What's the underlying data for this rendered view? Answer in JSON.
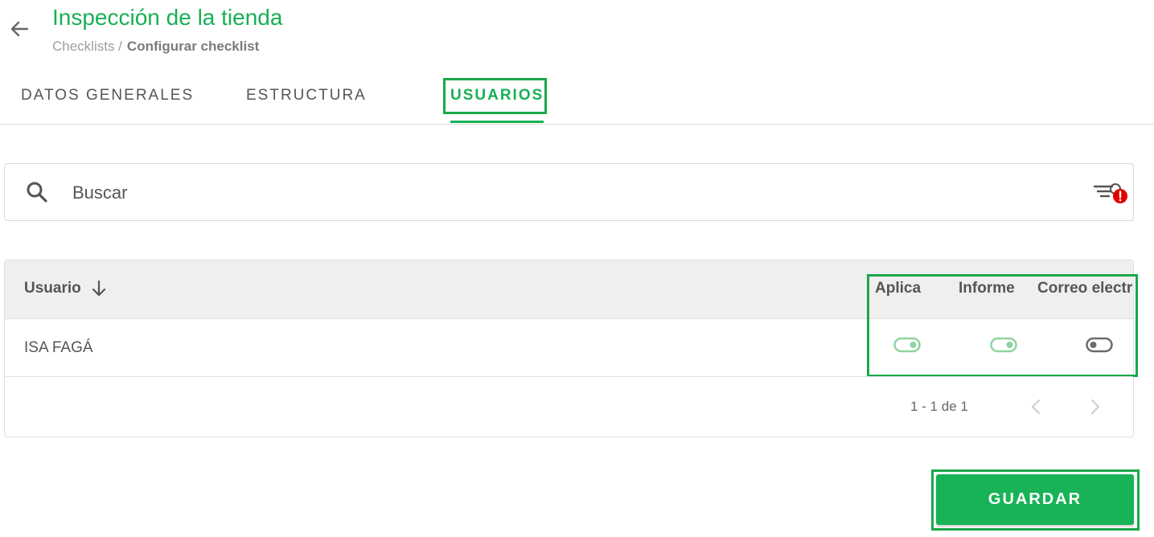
{
  "header": {
    "title": "Inspección de la tienda",
    "breadcrumb": {
      "parent": "Checklists /",
      "current": "Configurar checklist"
    }
  },
  "tabs": [
    {
      "label": "DATOS GENERALES",
      "active": false
    },
    {
      "label": "ESTRUCTURA",
      "active": false
    },
    {
      "label": "USUARIOS",
      "active": true
    }
  ],
  "search": {
    "placeholder": "Buscar",
    "value": ""
  },
  "table": {
    "columns": [
      "Usuario",
      "Aplica",
      "Informe",
      "Correo electr"
    ],
    "rows": [
      {
        "usuario": "ISA FAGÁ",
        "aplica": true,
        "informe": true,
        "correo": false
      }
    ]
  },
  "pagination": {
    "range": "1 - 1 de 1"
  },
  "actions": {
    "save_label": "GUARDAR"
  },
  "colors": {
    "accent": "#17b055",
    "toggle_on": "#8fd49f",
    "toggle_off": "#6b6b6b",
    "alert": "#e00000"
  }
}
